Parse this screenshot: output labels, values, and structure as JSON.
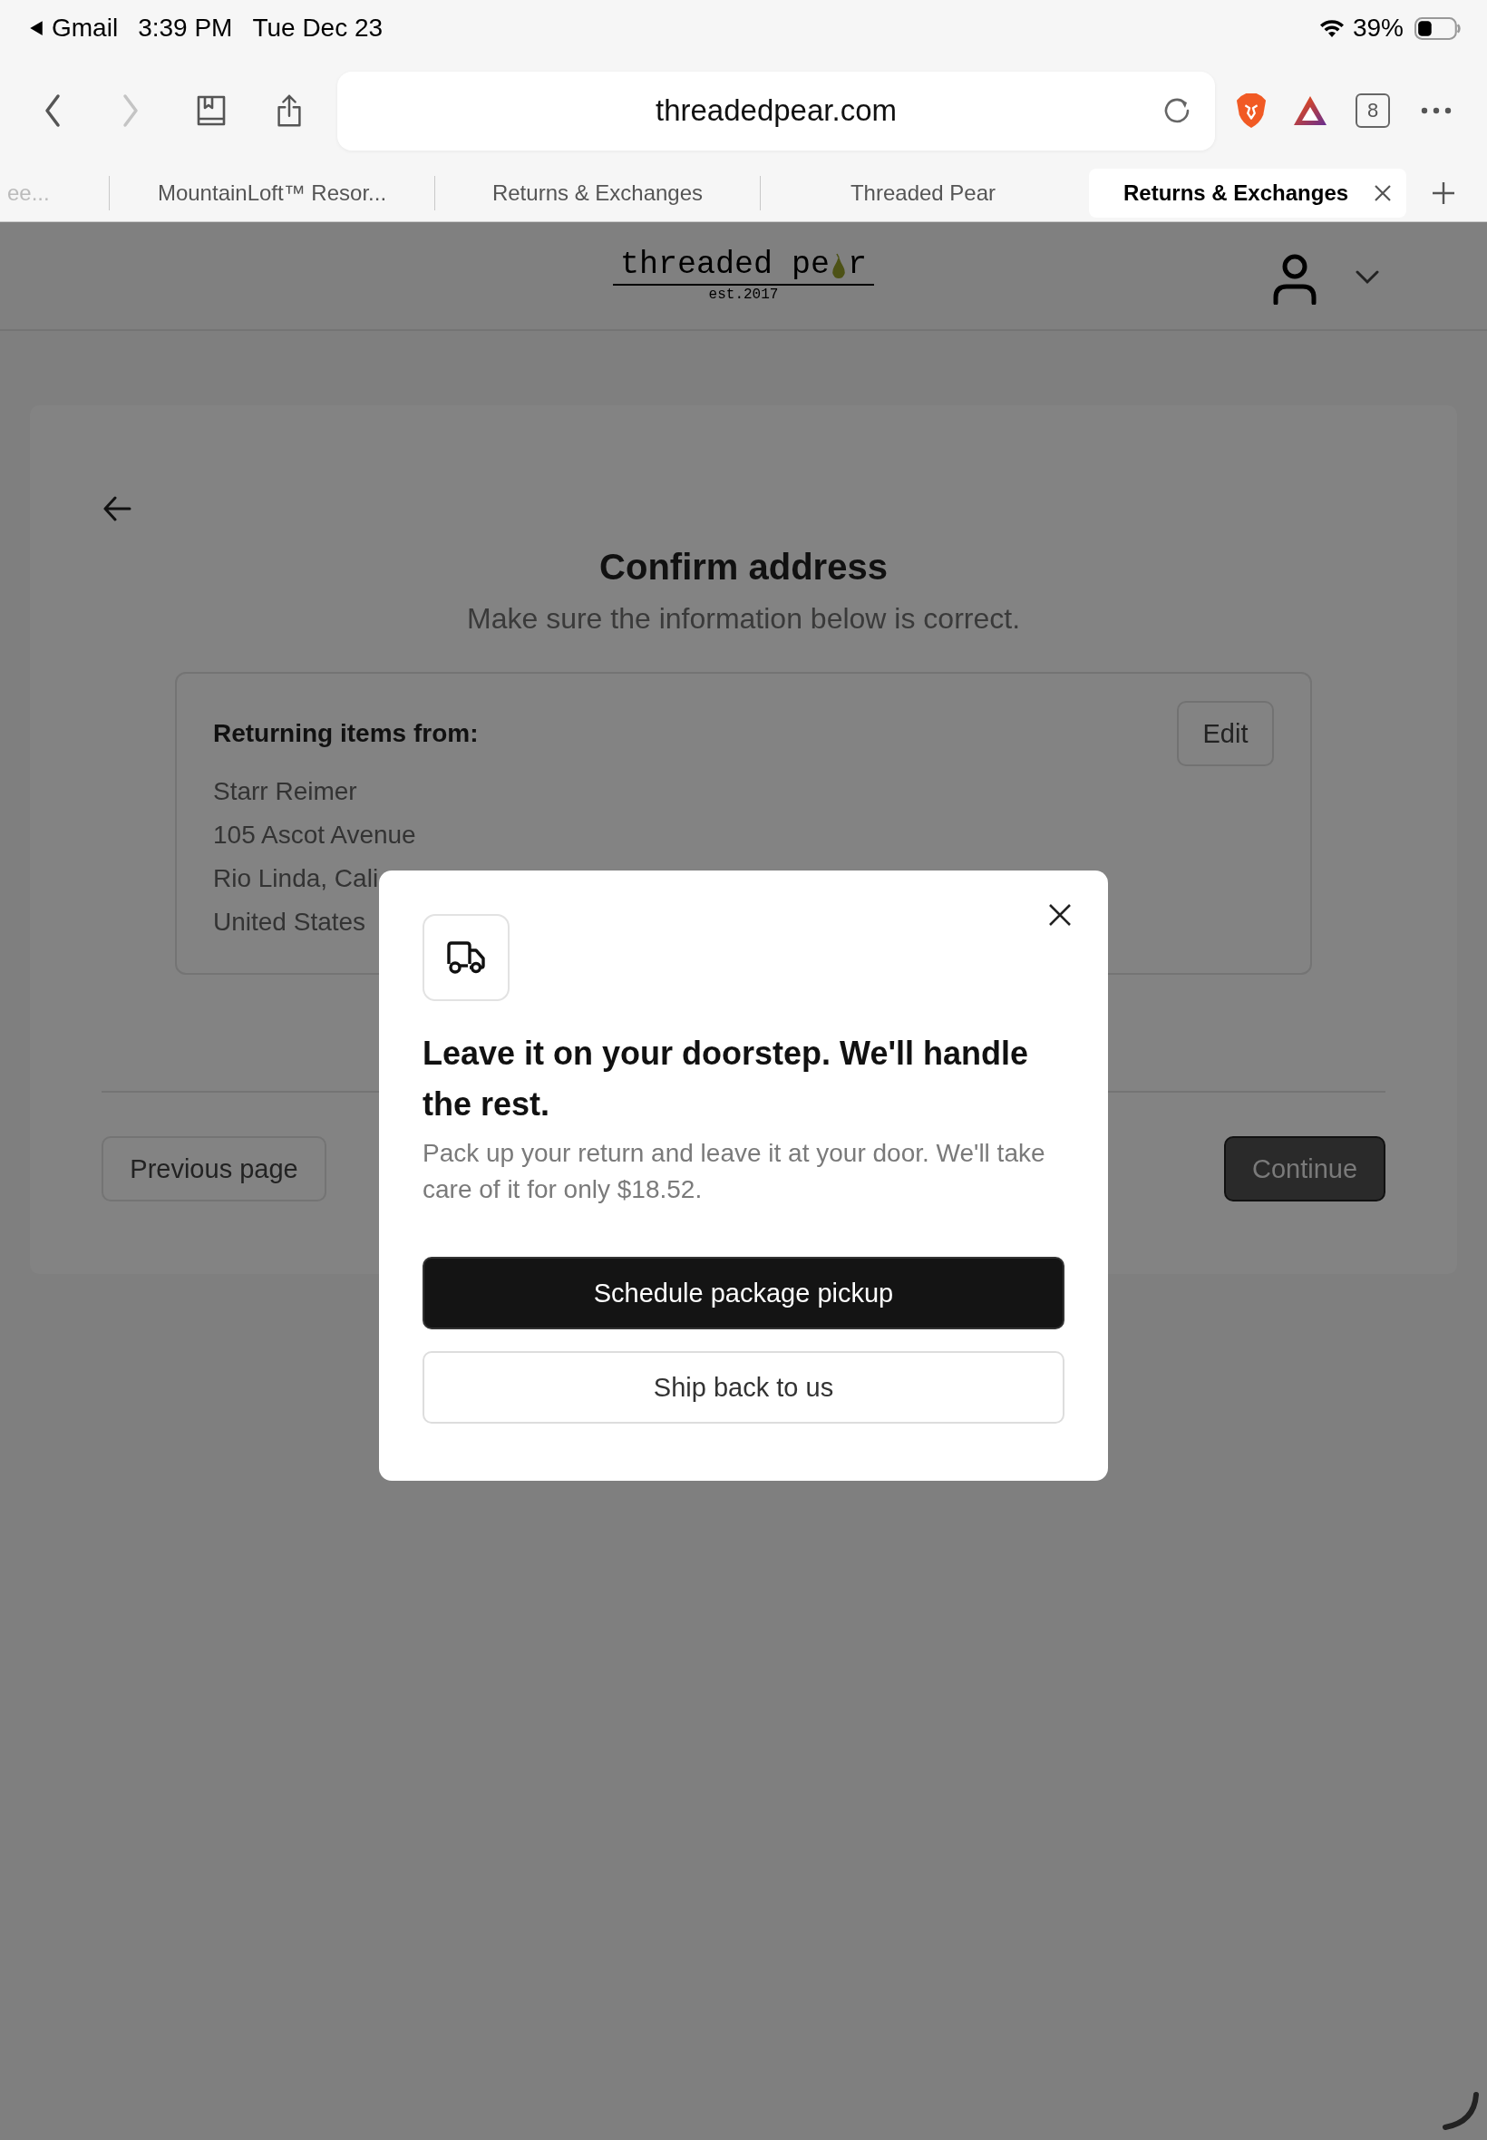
{
  "status_bar": {
    "back_app": "Gmail",
    "time": "3:39 PM",
    "date": "Tue Dec 23",
    "battery": "39%"
  },
  "browser": {
    "url": "threadedpear.com",
    "tab_count": "8",
    "tabs": [
      {
        "title": "ee...",
        "selected": false
      },
      {
        "title": "MountainLoft™ Resor...",
        "selected": false
      },
      {
        "title": "Returns & Exchanges",
        "selected": false
      },
      {
        "title": "Threaded Pear",
        "selected": false
      },
      {
        "title": "Returns & Exchanges",
        "selected": true
      }
    ]
  },
  "site_header": {
    "logo_before": "threaded pe",
    "logo_after": "r",
    "tagline": "est.2017"
  },
  "page": {
    "title": "Confirm address",
    "subtitle": "Make sure the information below is correct.",
    "address_card": {
      "heading": "Returning items from:",
      "edit_button": "Edit",
      "lines": [
        "Starr Reimer",
        "105 Ascot Avenue",
        "Rio Linda, Cali",
        "United States"
      ]
    },
    "previous_button": "Previous page",
    "continue_button": "Continue"
  },
  "modal": {
    "heading": "Leave it on your doorstep. We'll handle the rest.",
    "body": "Pack up your return and leave it at your door. We'll take care of it for only $18.52.",
    "primary_button": "Schedule package pickup",
    "secondary_button": "Ship back to us"
  }
}
